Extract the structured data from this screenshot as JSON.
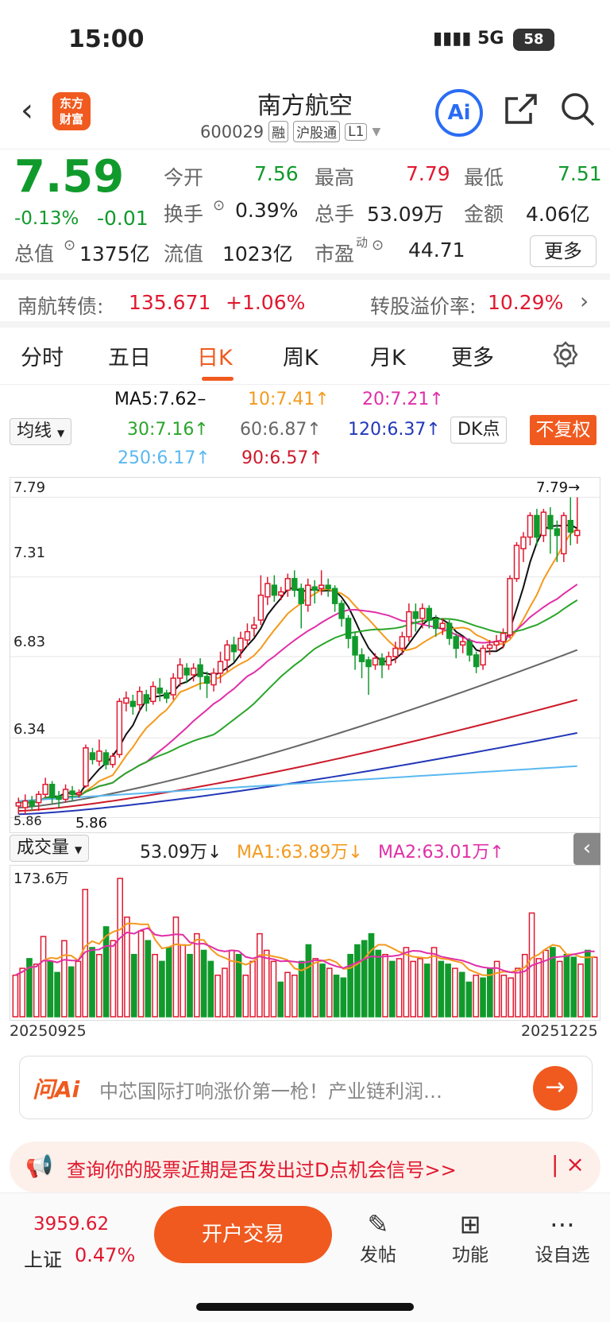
{
  "status_bar": {
    "time": "15:00",
    "network": "5G",
    "battery": "58"
  },
  "header": {
    "title": "南方航空",
    "logo_line1": "东方",
    "logo_line2": "财富",
    "code": "600029",
    "tags": [
      "融",
      "沪股通",
      "L1"
    ],
    "ai_label": "Ai"
  },
  "quote": {
    "price": "7.59",
    "change_pct": "-0.13%",
    "change": "-0.01",
    "open_label": "今开",
    "open": "7.56",
    "high_label": "最高",
    "high": "7.79",
    "low_label": "最低",
    "low": "7.51",
    "turnover_label": "换手",
    "turnover": "0.39%",
    "volume_label": "总手",
    "volume": "53.09万",
    "amount_label": "金额",
    "amount": "4.06亿",
    "mktcap_label": "总值",
    "mktcap": "1375亿",
    "float_label": "流值",
    "float": "1023亿",
    "pe_label": "市盈",
    "pe_sup": "动",
    "pe": "44.71",
    "more": "更多"
  },
  "bond": {
    "label": "南航转债:",
    "price": "135.671",
    "pct": "+1.06%",
    "premium_label": "转股溢价率:",
    "premium": "10.29%"
  },
  "tabs": [
    "分时",
    "五日",
    "日K",
    "周K",
    "月K",
    "更多"
  ],
  "active_tab": "日K",
  "ma_legend": {
    "selector": "均线",
    "dk": "DK点",
    "fq": "不复权",
    "ma5": "MA5:7.62–",
    "ma10": "10:7.41↑",
    "ma20": "20:7.21↑",
    "ma30": "30:7.16↑",
    "ma60": "60:6.87↑",
    "ma120": "120:6.37↑",
    "ma250": "250:6.17↑",
    "ma90": "90:6.57↑"
  },
  "colors": {
    "up": "#e0182f",
    "down": "#119a2c",
    "accent": "#f05a1f",
    "ma5": "#111111",
    "ma10": "#f39a1e",
    "ma20": "#e02fa8",
    "ma30": "#2aa52a",
    "ma60": "#666666",
    "ma90": "#cc1a2a",
    "ma120": "#2237b8",
    "ma250": "#5bb8f0"
  },
  "chart_data": {
    "type": "candlestick",
    "price_axis_labels": [
      "7.79",
      "7.31",
      "6.83",
      "6.34",
      "5.86"
    ],
    "ylim": [
      5.8,
      7.85
    ],
    "max_marker": "7.79→",
    "min_marker": "5.86",
    "start_date": "20250925",
    "end_date": "20251225",
    "volume_axis_max": "173.6万",
    "candles": [
      [
        5.93,
        5.95,
        5.88,
        5.98
      ],
      [
        5.92,
        5.96,
        5.88,
        6.0
      ],
      [
        5.96,
        5.93,
        5.9,
        5.99
      ],
      [
        5.95,
        6.0,
        5.9,
        6.02
      ],
      [
        6.0,
        6.06,
        5.98,
        6.1
      ],
      [
        6.06,
        5.98,
        5.94,
        6.08
      ],
      [
        5.99,
        5.97,
        5.92,
        6.02
      ],
      [
        5.97,
        6.03,
        5.95,
        6.06
      ],
      [
        6.02,
        6.0,
        5.96,
        6.05
      ],
      [
        6.0,
        6.01,
        5.98,
        6.03
      ],
      [
        6.05,
        6.28,
        6.04,
        6.3
      ],
      [
        6.25,
        6.21,
        6.18,
        6.28
      ],
      [
        6.2,
        6.26,
        6.17,
        6.33
      ],
      [
        6.25,
        6.18,
        6.15,
        6.27
      ],
      [
        6.18,
        6.23,
        6.16,
        6.25
      ],
      [
        6.24,
        6.56,
        6.22,
        6.58
      ],
      [
        6.55,
        6.58,
        6.5,
        6.62
      ],
      [
        6.56,
        6.53,
        6.48,
        6.6
      ],
      [
        6.54,
        6.62,
        6.5,
        6.65
      ],
      [
        6.6,
        6.55,
        6.5,
        6.63
      ],
      [
        6.56,
        6.65,
        6.54,
        6.68
      ],
      [
        6.64,
        6.61,
        6.56,
        6.7
      ],
      [
        6.61,
        6.58,
        6.55,
        6.63
      ],
      [
        6.6,
        6.7,
        6.57,
        6.73
      ],
      [
        6.7,
        6.78,
        6.65,
        6.82
      ],
      [
        6.76,
        6.72,
        6.67,
        6.79
      ],
      [
        6.72,
        6.76,
        6.68,
        6.79
      ],
      [
        6.78,
        6.71,
        6.63,
        6.82
      ],
      [
        6.71,
        6.67,
        6.58,
        6.74
      ],
      [
        6.66,
        6.73,
        6.62,
        6.76
      ],
      [
        6.73,
        6.8,
        6.67,
        6.86
      ],
      [
        6.81,
        6.9,
        6.74,
        6.93
      ],
      [
        6.9,
        6.86,
        6.8,
        6.95
      ],
      [
        6.87,
        6.94,
        6.82,
        6.98
      ],
      [
        6.93,
        6.98,
        6.89,
        7.03
      ],
      [
        7.0,
        7.02,
        6.95,
        7.07
      ],
      [
        7.05,
        7.2,
        7.02,
        7.32
      ],
      [
        7.19,
        7.27,
        7.14,
        7.31
      ],
      [
        7.26,
        7.2,
        7.16,
        7.32
      ],
      [
        7.2,
        7.22,
        7.17,
        7.25
      ],
      [
        7.23,
        7.3,
        7.19,
        7.33
      ],
      [
        7.3,
        7.23,
        7.19,
        7.35
      ],
      [
        7.24,
        7.15,
        7.0,
        7.27
      ],
      [
        7.14,
        7.26,
        7.1,
        7.3
      ],
      [
        7.25,
        7.23,
        7.15,
        7.29
      ],
      [
        7.24,
        7.26,
        7.2,
        7.35
      ],
      [
        7.26,
        7.24,
        7.19,
        7.3
      ],
      [
        7.24,
        7.15,
        7.1,
        7.26
      ],
      [
        7.15,
        7.06,
        7.01,
        7.17
      ],
      [
        7.06,
        6.94,
        6.88,
        7.08
      ],
      [
        6.95,
        6.84,
        6.75,
        6.98
      ],
      [
        6.84,
        6.8,
        6.7,
        6.88
      ],
      [
        6.81,
        6.77,
        6.6,
        6.83
      ],
      [
        6.78,
        6.82,
        6.75,
        6.85
      ],
      [
        6.82,
        6.78,
        6.7,
        6.85
      ],
      [
        6.78,
        6.83,
        6.75,
        6.86
      ],
      [
        6.83,
        6.88,
        6.79,
        6.92
      ],
      [
        6.88,
        6.95,
        6.84,
        6.98
      ],
      [
        6.95,
        7.1,
        6.92,
        7.15
      ],
      [
        7.1,
        7.06,
        6.98,
        7.15
      ],
      [
        7.06,
        7.12,
        7.0,
        7.15
      ],
      [
        7.12,
        7.05,
        7.0,
        7.14
      ],
      [
        7.05,
        7.0,
        6.95,
        7.08
      ],
      [
        7.0,
        7.03,
        6.96,
        7.06
      ],
      [
        7.03,
        6.94,
        6.9,
        7.05
      ],
      [
        6.95,
        6.88,
        6.82,
        6.97
      ],
      [
        6.9,
        6.92,
        6.85,
        6.95
      ],
      [
        6.92,
        6.84,
        6.8,
        6.94
      ],
      [
        6.84,
        6.77,
        6.73,
        6.86
      ],
      [
        6.78,
        6.88,
        6.75,
        6.9
      ],
      [
        6.88,
        6.9,
        6.84,
        6.93
      ],
      [
        6.9,
        6.92,
        6.87,
        6.96
      ],
      [
        6.92,
        6.97,
        6.88,
        7.0
      ],
      [
        6.96,
        7.3,
        6.94,
        7.32
      ],
      [
        7.3,
        7.5,
        7.28,
        7.52
      ],
      [
        7.48,
        7.55,
        7.4,
        7.58
      ],
      [
        7.55,
        7.68,
        7.5,
        7.7
      ],
      [
        7.68,
        7.55,
        7.5,
        7.72
      ],
      [
        7.56,
        7.7,
        7.52,
        7.72
      ],
      [
        7.68,
        7.6,
        7.45,
        7.73
      ],
      [
        7.6,
        7.56,
        7.4,
        7.65
      ],
      [
        7.45,
        7.68,
        7.4,
        7.7
      ],
      [
        7.65,
        7.58,
        7.5,
        7.79
      ],
      [
        7.56,
        7.59,
        7.51,
        7.79
      ]
    ],
    "volumes": [
      0.3,
      0.35,
      0.42,
      0.38,
      0.58,
      0.4,
      0.32,
      0.55,
      0.36,
      0.4,
      0.92,
      0.5,
      0.45,
      0.65,
      0.55,
      1.0,
      0.72,
      0.45,
      0.62,
      0.55,
      0.45,
      0.4,
      0.5,
      0.72,
      0.52,
      0.45,
      0.6,
      0.48,
      0.4,
      0.3,
      0.35,
      0.48,
      0.45,
      0.3,
      0.4,
      0.6,
      0.48,
      0.4,
      0.25,
      0.32,
      0.3,
      0.4,
      0.52,
      0.42,
      0.38,
      0.35,
      0.3,
      0.28,
      0.45,
      0.52,
      0.55,
      0.6,
      0.48,
      0.45,
      0.4,
      0.42,
      0.5,
      0.4,
      0.42,
      0.38,
      0.5,
      0.4,
      0.38,
      0.35,
      0.32,
      0.25,
      0.3,
      0.28,
      0.35,
      0.4,
      0.3,
      0.28,
      0.35,
      0.45,
      0.75,
      0.42,
      0.48,
      0.5,
      0.4,
      0.45,
      0.43,
      0.38,
      0.48,
      0.43
    ],
    "volume_legend": {
      "selector": "成交量",
      "current": "53.09万↓",
      "ma1": "MA1:63.89万↓",
      "ma2": "MA2:63.01万↑"
    }
  },
  "ai_bar": {
    "logo": "问Ai",
    "text": "中芯国际打响涨价第一枪！产业链利润…"
  },
  "notice": {
    "text": "查询你的股票近期是否发出过D点机会信号>>"
  },
  "bottom": {
    "index_value": "3959.62",
    "index_name": "上证",
    "index_pct": "0.47%",
    "trade": "开户交易",
    "post": "发帖",
    "func": "功能",
    "watch": "设自选"
  }
}
